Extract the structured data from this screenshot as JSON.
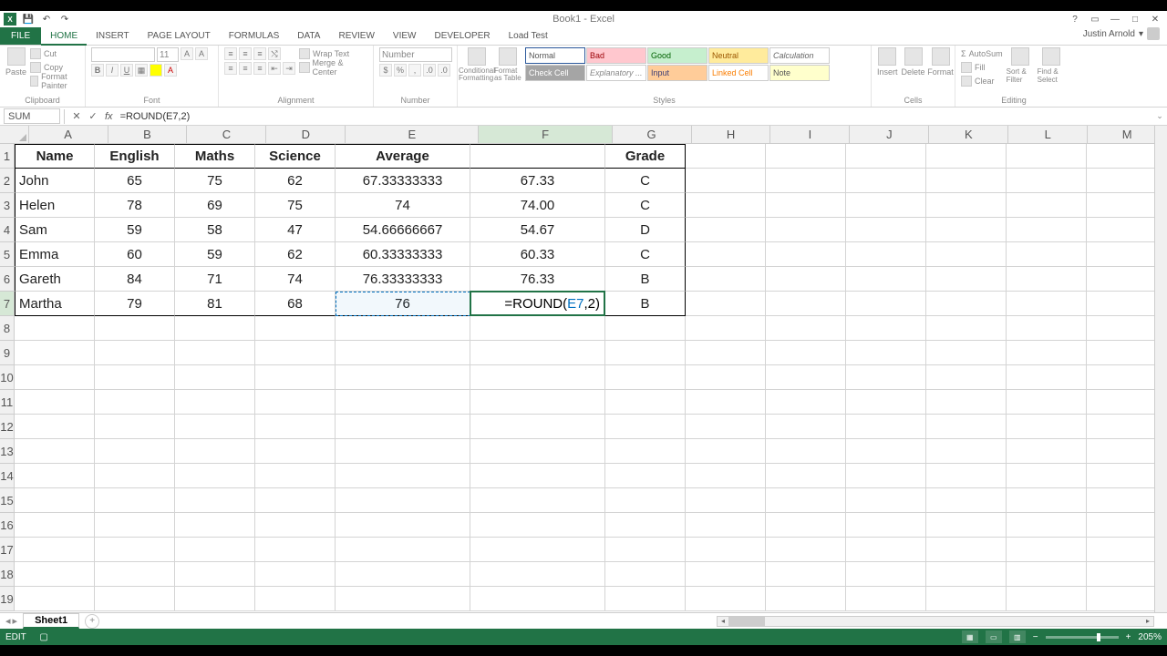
{
  "window": {
    "title": "Book1 - Excel",
    "user": "Justin Arnold"
  },
  "ribbon_tabs": {
    "file": "FILE",
    "items": [
      "HOME",
      "INSERT",
      "PAGE LAYOUT",
      "FORMULAS",
      "DATA",
      "REVIEW",
      "VIEW",
      "DEVELOPER",
      "Load Test"
    ],
    "active_index": 0
  },
  "ribbon": {
    "clipboard": {
      "paste": "Paste",
      "cut": "Cut",
      "copy": "Copy",
      "painter": "Format Painter",
      "label": "Clipboard"
    },
    "font": {
      "name": "",
      "size": "11",
      "label": "Font"
    },
    "alignment": {
      "wrap": "Wrap Text",
      "merge": "Merge & Center",
      "label": "Alignment"
    },
    "number": {
      "format": "Number",
      "label": "Number"
    },
    "styles": {
      "conditional": "Conditional Formatting",
      "formatas": "Format as Table",
      "gallery": [
        "Normal",
        "Bad",
        "Good",
        "Neutral",
        "Calculation",
        "Check Cell",
        "Explanatory ...",
        "Input",
        "Linked Cell",
        "Note"
      ],
      "label": "Styles"
    },
    "cells": {
      "insert": "Insert",
      "delete": "Delete",
      "format": "Format",
      "label": "Cells"
    },
    "editing": {
      "autosum": "AutoSum",
      "fill": "Fill",
      "clear": "Clear",
      "sort": "Sort & Filter",
      "find": "Find & Select",
      "label": "Editing"
    }
  },
  "formula_bar": {
    "name_box": "SUM",
    "formula": "=ROUND(E7,2)"
  },
  "columns": [
    "A",
    "B",
    "C",
    "D",
    "E",
    "F",
    "G",
    "H",
    "I",
    "J",
    "K",
    "L",
    "M"
  ],
  "sheet": {
    "headers": {
      "A": "Name",
      "B": "English",
      "C": "Maths",
      "D": "Science",
      "E": "Average",
      "F": "",
      "G": "Grade"
    },
    "rows": [
      {
        "A": "John",
        "B": "65",
        "C": "75",
        "D": "62",
        "E": "67.33333333",
        "F": "67.33",
        "G": "C"
      },
      {
        "A": "Helen",
        "B": "78",
        "C": "69",
        "D": "75",
        "E": "74",
        "F": "74.00",
        "G": "C"
      },
      {
        "A": "Sam",
        "B": "59",
        "C": "58",
        "D": "47",
        "E": "54.66666667",
        "F": "54.67",
        "G": "D"
      },
      {
        "A": "Emma",
        "B": "60",
        "C": "59",
        "D": "62",
        "E": "60.33333333",
        "F": "60.33",
        "G": "C"
      },
      {
        "A": "Gareth",
        "B": "84",
        "C": "71",
        "D": "74",
        "E": "76.33333333",
        "F": "76.33",
        "G": "B"
      },
      {
        "A": "Martha",
        "B": "79",
        "C": "81",
        "D": "68",
        "E": "76",
        "F": "",
        "G": "B"
      }
    ],
    "editing_cell": {
      "address": "F7",
      "display_prefix": "=ROUND(",
      "display_ref": "E7",
      "display_suffix": ",2)"
    },
    "ref_highlight": "E7"
  },
  "sheet_tabs": {
    "active": "Sheet1"
  },
  "statusbar": {
    "mode": "EDIT",
    "zoom": "205%"
  }
}
